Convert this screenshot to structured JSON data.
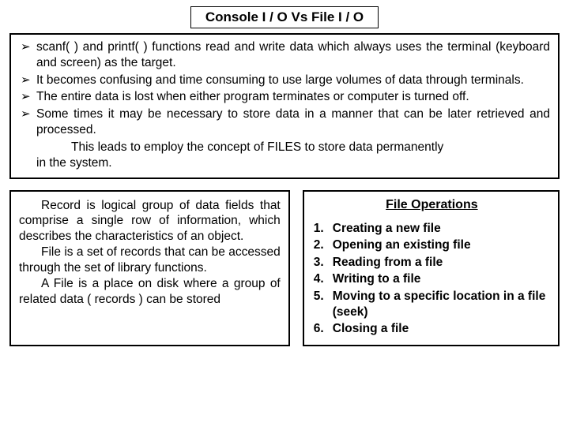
{
  "title": "Console I / O  Vs  File I / O",
  "bullets": [
    "scanf( ) and printf( ) functions read and write data which always uses the terminal (keyboard and screen) as the target.",
    "It becomes confusing and time consuming to use large volumes of data through terminals.",
    "The entire data is lost when either program terminates or computer is turned off.",
    "Some times it may be necessary to store data in a manner that can be later retrieved and processed."
  ],
  "follow1": "This leads to employ the concept of FILES to store data permanently",
  "follow2": "in the system.",
  "left": {
    "p1": "Record is logical group of data fields that comprise a single row of information, which describes the characteristics of an object.",
    "p2": "File is a set of records that can be accessed through the set of library functions.",
    "p3": "A File is a place on disk where a group of related data ( records ) can be stored"
  },
  "ops": {
    "title": "File Operations",
    "items": [
      "Creating a new file",
      "Opening an existing file",
      "Reading from a file",
      "Writing to a file",
      "Moving to a specific location in a file (seek)",
      "Closing a file"
    ],
    "nums": [
      "1.",
      "2.",
      "3.",
      "4.",
      "5.",
      "6."
    ]
  }
}
